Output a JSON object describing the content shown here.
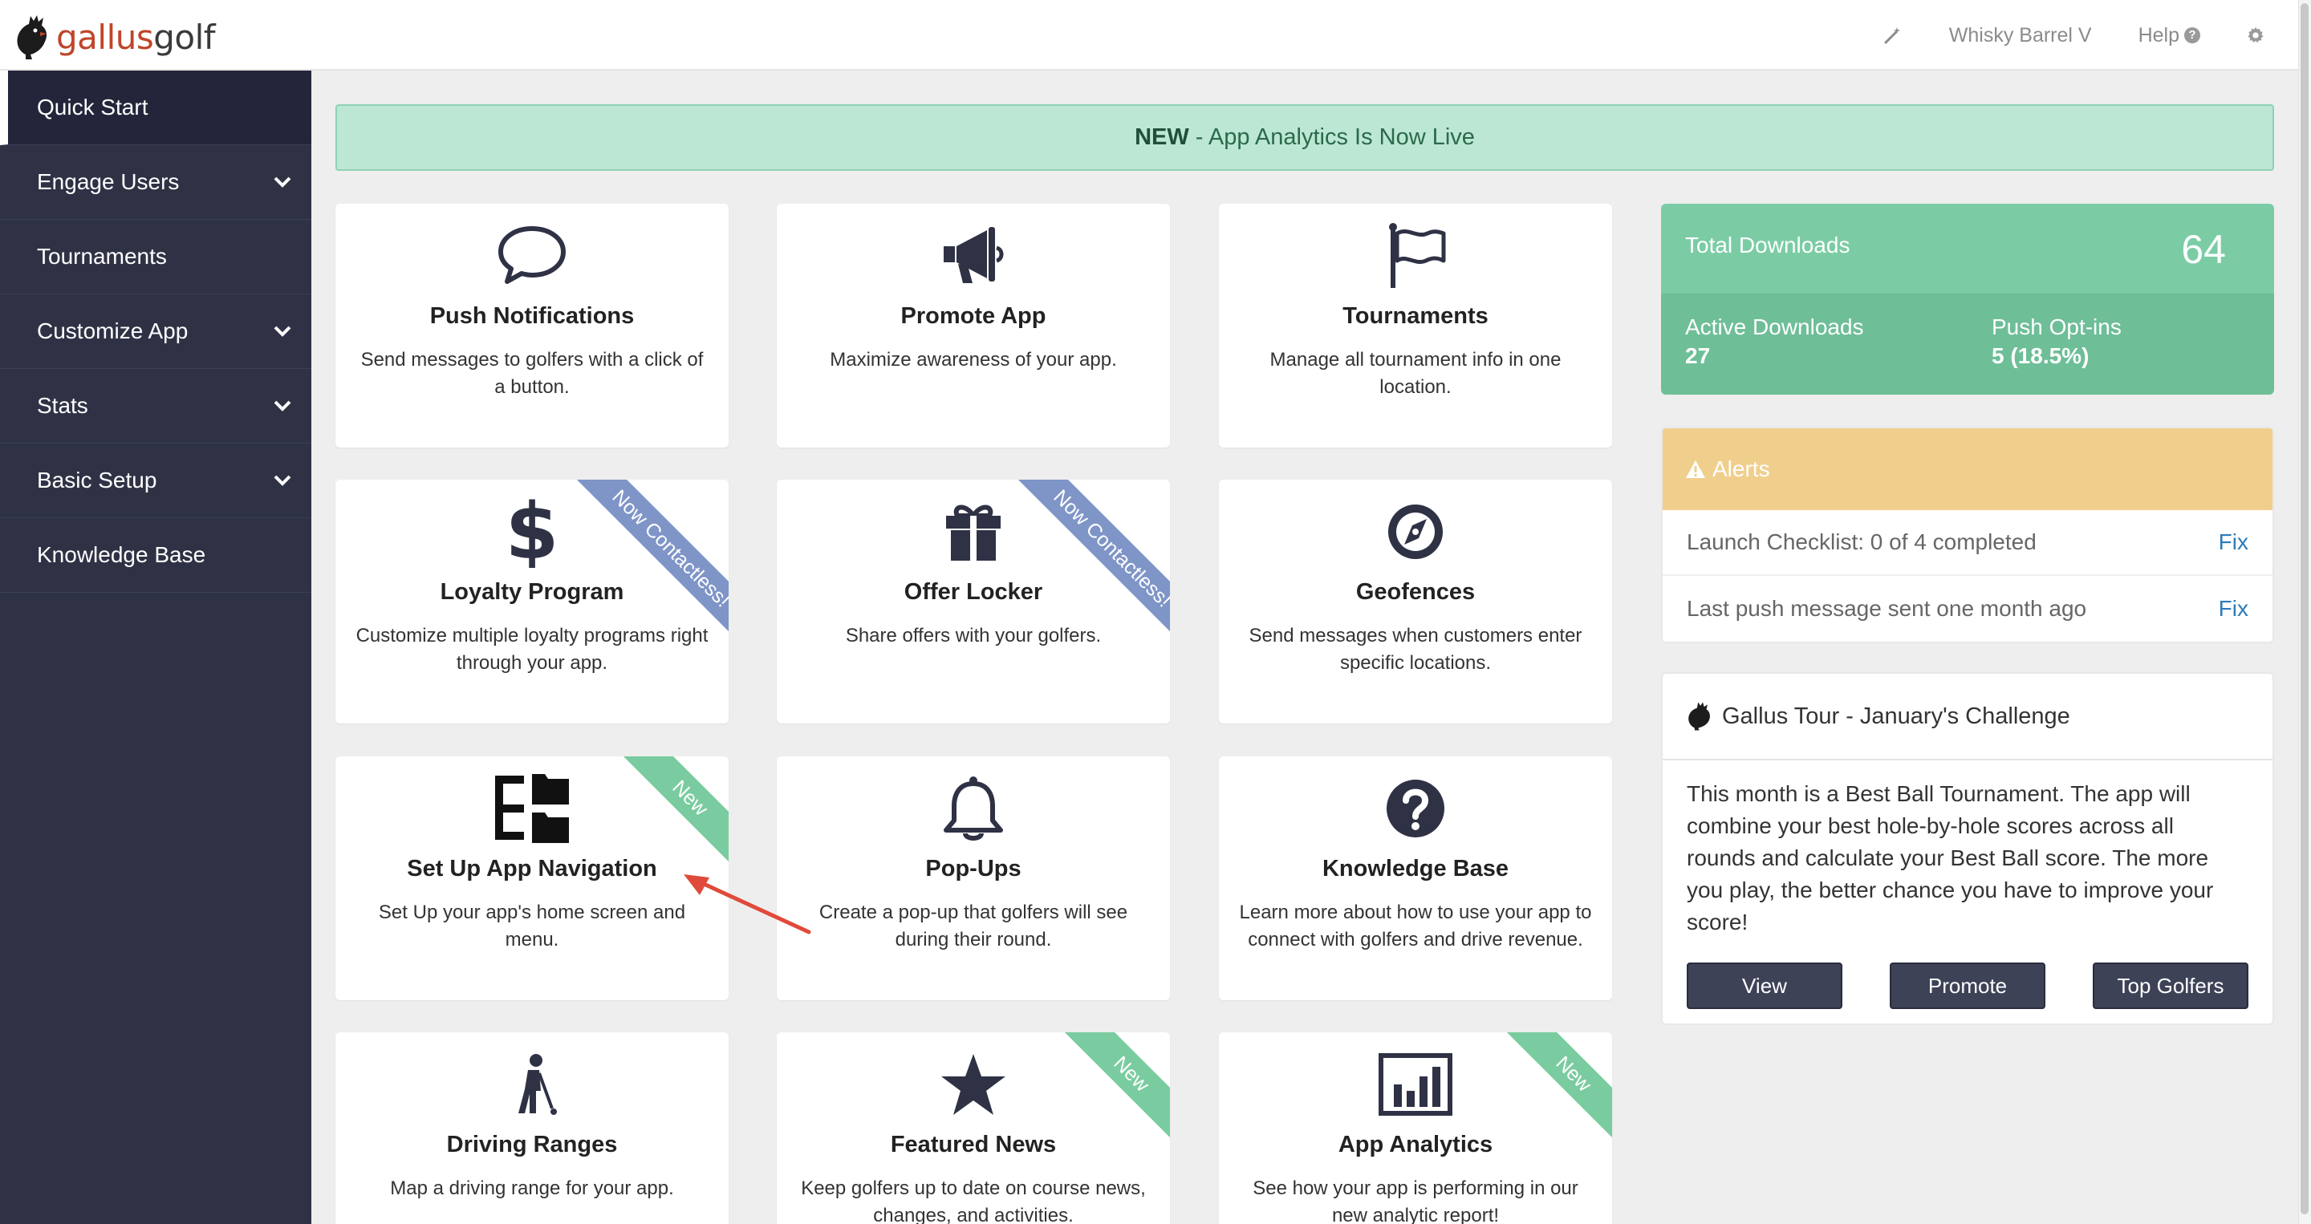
{
  "header": {
    "logo_part1": "gallus",
    "logo_part2": "golf",
    "account_name": "Whisky Barrel V",
    "help_label": "Help",
    "help_glyph": "?"
  },
  "sidebar": {
    "items": [
      {
        "label": "Quick Start"
      },
      {
        "label": "Engage Users"
      },
      {
        "label": "Tournaments"
      },
      {
        "label": "Customize App"
      },
      {
        "label": "Stats"
      },
      {
        "label": "Basic Setup"
      },
      {
        "label": "Knowledge Base"
      }
    ]
  },
  "banner": {
    "bold": "NEW",
    "text": "- App Analytics Is Now Live"
  },
  "cards": [
    {
      "title": "Push Notifications",
      "desc": "Send messages to golfers with a click of a button.",
      "icon": "speech-bubble-icon"
    },
    {
      "title": "Promote App",
      "desc": "Maximize awareness of your app.",
      "icon": "megaphone-icon"
    },
    {
      "title": "Tournaments",
      "desc": "Manage all tournament info in one location.",
      "icon": "flag-icon"
    },
    {
      "title": "Loyalty Program",
      "desc": "Customize multiple loyalty programs right through your app.",
      "icon": "dollar-icon",
      "ribbon": "Now Contactless!"
    },
    {
      "title": "Offer Locker",
      "desc": "Share offers with your golfers.",
      "icon": "gift-icon",
      "ribbon": "Now Contactless!"
    },
    {
      "title": "Geofences",
      "desc": "Send messages when customers enter specific locations.",
      "icon": "compass-icon"
    },
    {
      "title": "Set Up App Navigation",
      "desc": "Set Up your app's home screen and menu.",
      "icon": "sitemap-icon",
      "ribbon": "New"
    },
    {
      "title": "Pop-Ups",
      "desc": "Create a pop-up that golfers will see during their round.",
      "icon": "bell-icon"
    },
    {
      "title": "Knowledge Base",
      "desc": "Learn more about how to use your app to connect with golfers and drive revenue.",
      "icon": "question-circle-icon"
    },
    {
      "title": "Driving Ranges",
      "desc": "Map a driving range for your app.",
      "icon": "golfer-icon"
    },
    {
      "title": "Featured News",
      "desc": "Keep golfers up to date on course news, changes, and activities.",
      "icon": "star-icon",
      "ribbon": "New"
    },
    {
      "title": "App Analytics",
      "desc": "See how your app is performing in our new analytic report!",
      "icon": "bar-chart-icon",
      "ribbon": "New"
    }
  ],
  "stats": {
    "total_label": "Total Downloads",
    "total_value": "64",
    "active_label": "Active Downloads",
    "active_value": "27",
    "push_label": "Push Opt-ins",
    "push_value": "5 (18.5%)"
  },
  "alerts": {
    "title": "Alerts",
    "rows": [
      {
        "text": "Launch Checklist: 0 of 4 completed",
        "action": "Fix"
      },
      {
        "text": "Last push message sent one month ago",
        "action": "Fix"
      }
    ]
  },
  "tour": {
    "title": "Gallus Tour - January's Challenge",
    "body": "This month is a Best Ball Tournament. The app will combine your best hole-by-hole scores across all rounds and calculate your Best Ball score. The more you play, the better chance you have to improve your score!",
    "buttons": [
      "View",
      "Promote",
      "Top Golfers"
    ]
  },
  "colors": {
    "sidebar": "#2f3245",
    "accent_green": "#7bcca5",
    "alert_yellow": "#f0cf8d",
    "ribbon_blue": "#7f95c8",
    "ribbon_green": "#7acca0",
    "arrow_red": "#e04a3a"
  }
}
